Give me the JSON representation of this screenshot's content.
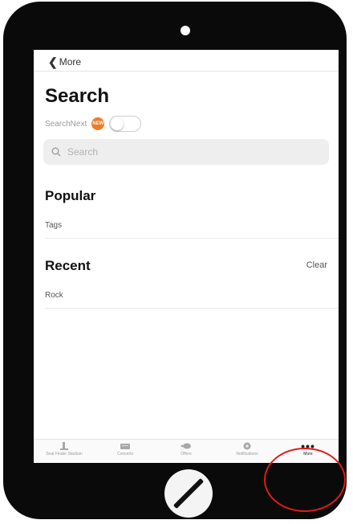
{
  "nav": {
    "back_label": "More"
  },
  "page": {
    "title": "Search",
    "toggle_label": "SearchNext",
    "new_badge": "NEW",
    "toggle_on": false
  },
  "search": {
    "placeholder": "Search",
    "value": ""
  },
  "popular": {
    "heading": "Popular",
    "items": [
      "Tags"
    ]
  },
  "recent": {
    "heading": "Recent",
    "clear_label": "Clear",
    "items": [
      "Rock"
    ]
  },
  "tabbar": {
    "tabs": [
      {
        "label": "Seat Finder Stadium",
        "icon": "stadium-icon",
        "active": false
      },
      {
        "label": "Concerts",
        "icon": "ticket-icon",
        "active": false
      },
      {
        "label": "Offers",
        "icon": "offers-icon",
        "active": false
      },
      {
        "label": "Notifications",
        "icon": "notification-icon",
        "active": false
      },
      {
        "label": "More",
        "icon": "more-icon",
        "active": true
      }
    ]
  },
  "colors": {
    "device": "#0a0a0a",
    "accent_badge": "#f07b24",
    "highlight_ring": "#e01b1b"
  }
}
